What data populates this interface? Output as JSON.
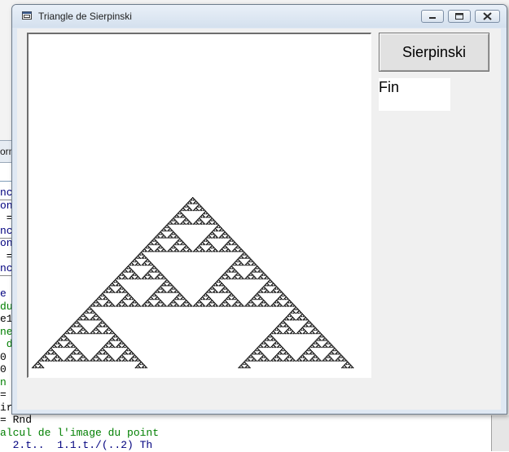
{
  "window": {
    "title": "Triangle de Sierpinski"
  },
  "form": {
    "button_label": "Sierpinski",
    "status_text": "Fin"
  },
  "background_editor": {
    "partial_title": "orm",
    "code_lines": [
      {
        "text": "nc",
        "style": "blue sep"
      },
      {
        "text": "on",
        "style": "blue"
      },
      {
        "text": " =",
        "style": "plain"
      },
      {
        "text": "nc",
        "style": "blue sep"
      },
      {
        "text": "on",
        "style": "blue"
      },
      {
        "text": " =",
        "style": "plain"
      },
      {
        "text": "nc",
        "style": "blue sep"
      },
      {
        "text": "",
        "style": "plain"
      },
      {
        "text": "e",
        "style": "blue"
      },
      {
        "text": "du",
        "style": "green"
      },
      {
        "text": "e1",
        "style": "plain"
      },
      {
        "text": "ne",
        "style": "green"
      },
      {
        "text": " d",
        "style": "green"
      },
      {
        "text": "0",
        "style": "plain"
      },
      {
        "text": "0",
        "style": "plain"
      },
      {
        "text": "n",
        "style": "green"
      },
      {
        "text": "=",
        "style": "plain"
      },
      {
        "text": "irg",
        "style": "plain"
      },
      {
        "text": "= Rnd",
        "style": "plain"
      },
      {
        "text": "alcul de l'image du point",
        "style": "green"
      },
      {
        "text": "  2.t..  1.1.t./(..2) Th",
        "style": "blue"
      }
    ]
  },
  "fractal": {
    "fill_color": "#000000",
    "background_color": "#ffffff"
  }
}
